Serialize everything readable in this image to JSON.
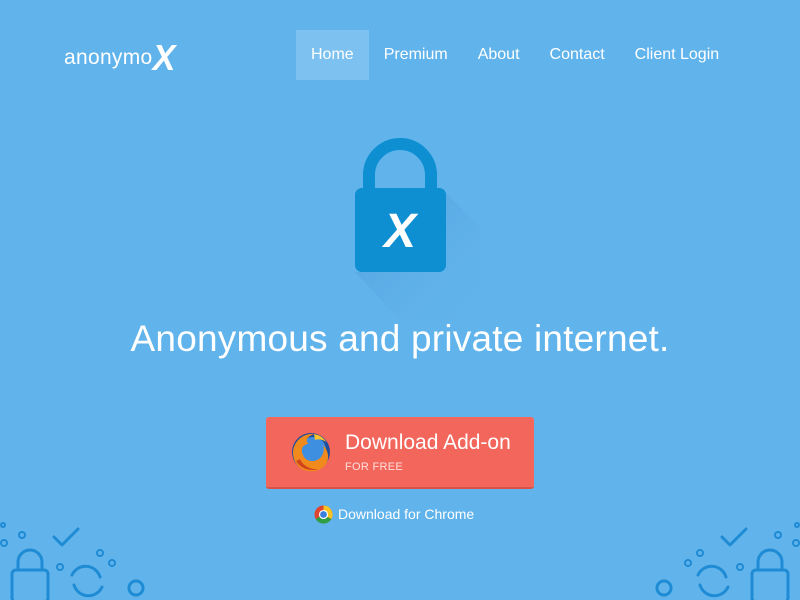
{
  "brand": {
    "name_prefix": "anonymo",
    "name_mark": "X"
  },
  "nav": {
    "items": [
      {
        "label": "Home",
        "active": true
      },
      {
        "label": "Premium",
        "active": false
      },
      {
        "label": "About",
        "active": false
      },
      {
        "label": "Contact",
        "active": false
      },
      {
        "label": "Client Login",
        "active": false
      }
    ]
  },
  "hero": {
    "lock_mark": "X",
    "headline": "Anonymous and private internet."
  },
  "download": {
    "title": "Download Add-on",
    "subtitle": "FOR FREE",
    "chrome_link": "Download for Chrome"
  },
  "colors": {
    "background": "#61b3eb",
    "lock": "#0d8fd2",
    "button": "#f2665c",
    "nav_active": "#7cc1ef",
    "decoration": "#1e8bd4"
  }
}
